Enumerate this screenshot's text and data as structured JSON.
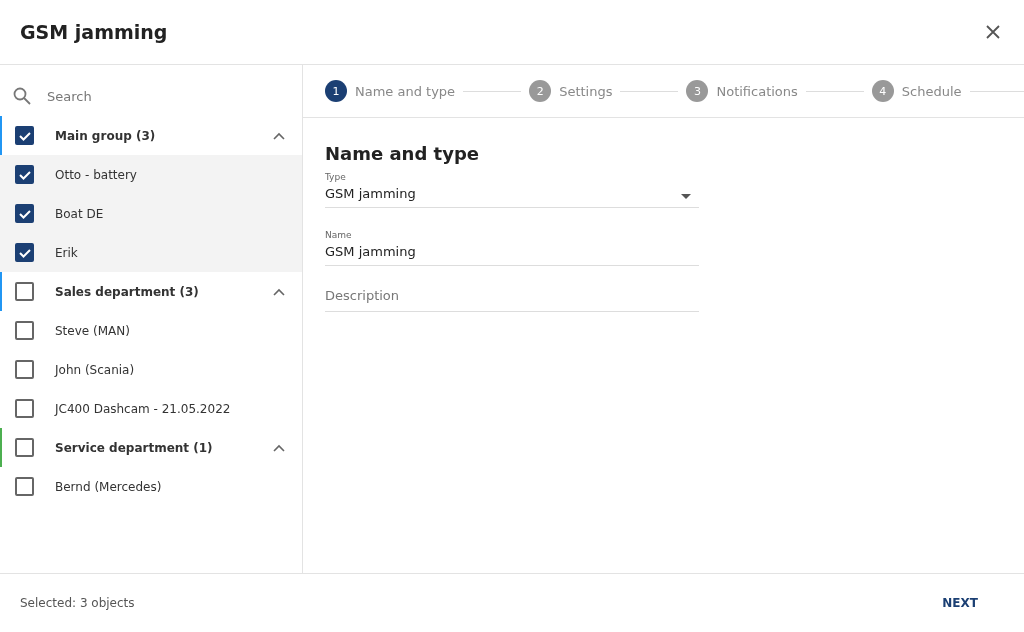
{
  "window": {
    "title": "GSM jamming"
  },
  "search": {
    "placeholder": "Search"
  },
  "groups": [
    {
      "name": "Main group (3)",
      "checked": true,
      "expanded": true,
      "color": "#2196f3",
      "items": [
        {
          "name": "Otto - battery",
          "checked": true
        },
        {
          "name": "Boat DE",
          "checked": true
        },
        {
          "name": "Erik",
          "checked": true
        }
      ]
    },
    {
      "name": "Sales department (3)",
      "checked": false,
      "expanded": true,
      "color": "#2196f3",
      "items": [
        {
          "name": "Steve (MAN)",
          "checked": false
        },
        {
          "name": "John (Scania)",
          "checked": false
        },
        {
          "name": "JC400 Dashcam - 21.05.2022",
          "checked": false
        }
      ]
    },
    {
      "name": "Service department (1)",
      "checked": false,
      "expanded": true,
      "color": "#4caf50",
      "items": [
        {
          "name": "Bernd (Mercedes)",
          "checked": false
        }
      ]
    }
  ],
  "steps": [
    {
      "number": "1",
      "label": "Name and type",
      "selected": true
    },
    {
      "number": "2",
      "label": "Settings",
      "selected": false
    },
    {
      "number": "3",
      "label": "Notifications",
      "selected": false
    },
    {
      "number": "4",
      "label": "Schedule",
      "selected": false
    }
  ],
  "form": {
    "heading": "Name and type",
    "type": {
      "label": "Type",
      "value": "GSM jamming"
    },
    "name": {
      "label": "Name",
      "value": "GSM jamming"
    },
    "description": {
      "placeholder": "Description"
    }
  },
  "footer": {
    "status": "Selected: 3 objects",
    "next": "NEXT"
  }
}
